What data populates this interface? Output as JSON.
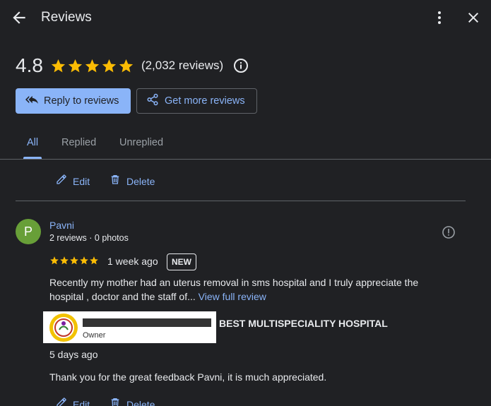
{
  "header": {
    "title": "Reviews"
  },
  "summary": {
    "rating": "4.8",
    "stars": 5,
    "count_text": "(2,032 reviews)"
  },
  "actions": {
    "reply_label": "Reply to reviews",
    "get_more_label": "Get more reviews"
  },
  "tabs": [
    {
      "label": "All",
      "active": true
    },
    {
      "label": "Replied",
      "active": false
    },
    {
      "label": "Unreplied",
      "active": false
    }
  ],
  "prev_reply_actions": {
    "edit_label": "Edit",
    "delete_label": "Delete"
  },
  "review": {
    "avatar_letter": "P",
    "avatar_color": "#689f38",
    "reviewer_name": "Pavni",
    "reviewer_meta": "2 reviews · 0 photos",
    "stars": 5,
    "time": "1 week ago",
    "badge": "NEW",
    "text": "Recently my mother had an uterus removal in sms hospital and I truly appreciate the hospital , doctor and the staff of...",
    "view_full_label": "View full review"
  },
  "owner_reply": {
    "owner_role": "Owner",
    "business_name": "BEST MULTISPECIALITY HOSPITAL",
    "time": "5 days ago",
    "text": "Thank you for the great feedback Pavni, it is much appreciated.",
    "edit_label": "Edit",
    "delete_label": "Delete"
  },
  "colors": {
    "background": "#202124",
    "accent": "#8ab4f8",
    "star": "#fbbc04",
    "divider": "#5f6368"
  }
}
